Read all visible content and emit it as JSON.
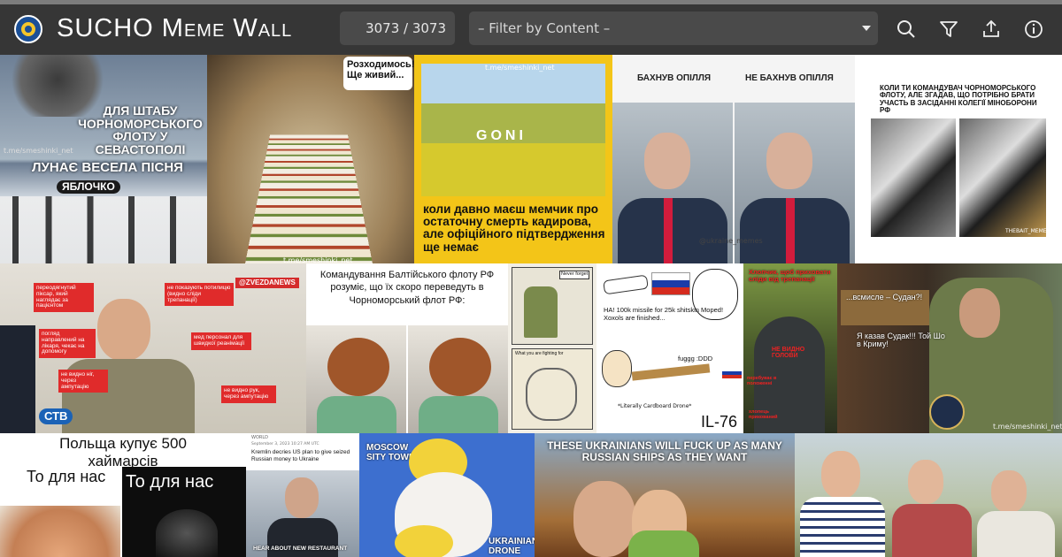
{
  "app": {
    "title": "SUCHO Meme Wall"
  },
  "header": {
    "counter": "3073 / 3073",
    "filter_placeholder": "– Filter by Content –",
    "icons": [
      "search-icon",
      "filter-icon",
      "share-icon",
      "info-icon"
    ]
  },
  "memes": {
    "m1": {
      "caption_a": "ДЛЯ ШТАБУ ЧОРНОМОРСЬКОГО ФЛОТУ У СЕВАСТОПОЛІ",
      "caption_b": "ЛУНАЄ ВЕСЕЛА ПІСНЯ",
      "song": "ЯБЛОЧКО",
      "watermark": "t.me/smeshinki_net"
    },
    "m2": {
      "bubble": "Розходимось! Ще живий...",
      "watermark": "t.me/smeshinki_net"
    },
    "m3": {
      "caption": "коли давно маєш мемчик про остаточну смерть кадирова, але офіційного підтвердження ще немає",
      "watermark": "t.me/smeshinki_net",
      "overlay": "GONI"
    },
    "m4": {
      "left": "БАХНУВ ОПІЛЛЯ",
      "right": "НЕ БАХНУВ ОПІЛЛЯ",
      "watermark": "@ukraine_memes"
    },
    "m5": {
      "caption": "КОЛИ ТИ КОМАНДУВАЧ ЧОРНОМОРСЬКОГО ФЛОТУ, АЛЕ ЗГАДАВ, ЩО ПОТРІБНО БРАТИ УЧАСТЬ В ЗАСІДАННІ КОЛЕГІЇ МІНОБОРОНИ РФ",
      "watermark": "THEBAIT_MEMES"
    },
    "m6": {
      "tag": "@ZVEZDANEWS",
      "labels": [
        "переодягнутий піксар, який наглядає за пацієнтом",
        "не показують потилицю (видно сліди трепанації)",
        "погляд направлений на лікаря, чекає на допомогу",
        "мед персонал для швидкої реанімації",
        "не видно ніг, через ампутацію",
        "не видно рук, через ампутацію"
      ],
      "mic": "СТВ"
    },
    "m7": {
      "caption": "Командування Балтійського флоту РФ розуміє, що їх скоро переведуть в Чорноморський флот РФ:"
    },
    "m8": {
      "top": "Never forget",
      "bottom": "What you are fighting for"
    },
    "m9": {
      "text1": "HA! 100k missile for 25k shitskin Moped! Xoxols are finished...",
      "text2": "fuggg :DDD",
      "note": "*Literally Cardboard Drone*",
      "plane": "IL-76"
    },
    "m10": {
      "caption": "Хлопчик, щоб приховати сліди від трепанації",
      "inner": "НЕ ВИДНО ГОЛОВИ",
      "side1": "перебуває в положенні",
      "side2": "хлопець прикований"
    },
    "m11": {
      "caption": "...всмисле – Судан?!",
      "reply": "Я казав Судак!!! Той Шо в Криму!",
      "watermark": "t.me/smeshinki_net"
    },
    "m12": {
      "title": "Польща купує 500 хаймарсів",
      "left": "То для нас",
      "right": "То для нас"
    },
    "m13": {
      "source": "WORLD",
      "date": "September 3, 2023 10:27 AM UTC",
      "headline": "Kremlin decries US plan to give seized Russian money to Ukraine",
      "bottom": "HEAR ABOUT NEW RESTAURANT"
    },
    "m14": {
      "top": "MOSCOW SITY TOWER",
      "bottom": "UKRAINIAN DRONE"
    },
    "m15": {
      "caption": "THESE UKRAINIANS WILL FUCK UP AS MANY RUSSIAN SHIPS AS THEY WANT"
    }
  }
}
